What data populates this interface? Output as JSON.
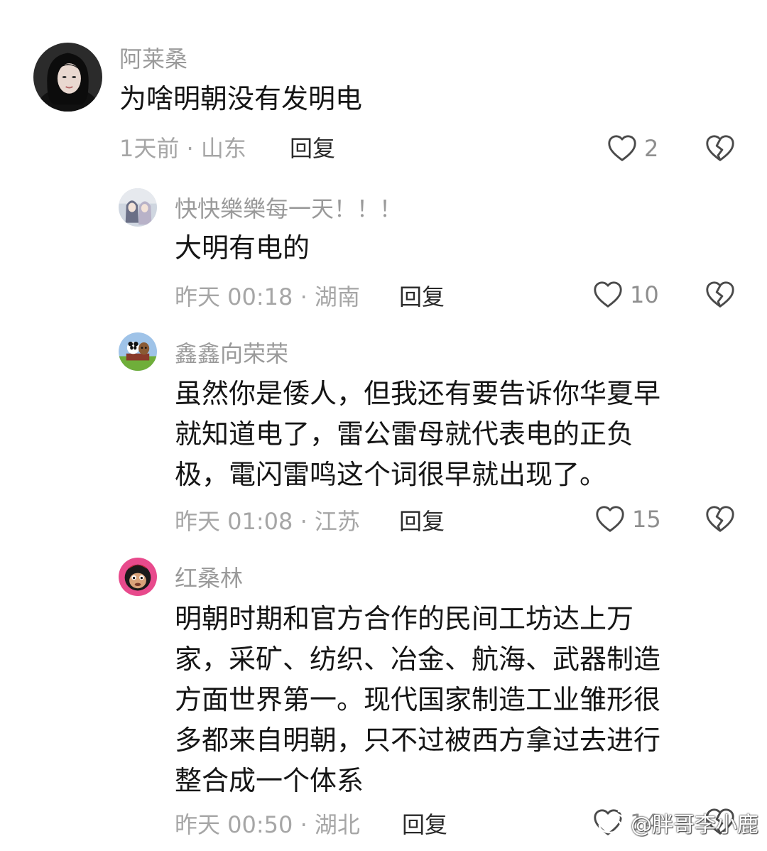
{
  "comments": [
    {
      "username": "阿莱桑",
      "text": "为啥明朝没有发明电",
      "meta": "1天前 · 山东",
      "reply_label": "回复",
      "likes": "2"
    },
    {
      "username": "快快樂樂每一天！！！",
      "text": "大明有电的",
      "meta": "昨天 00:18 · 湖南",
      "reply_label": "回复",
      "likes": "10"
    },
    {
      "username": "鑫鑫向荣荣",
      "text_lines": [
        "虽然你是倭人，但我还有要告诉你华夏早",
        "就知道电了，雷公雷母就代表电的正负",
        "极，電闪雷鸣这个词很早就出现了。"
      ],
      "meta": "昨天 01:08 · 江苏",
      "reply_label": "回复",
      "likes": "15"
    },
    {
      "username": "红桑林",
      "text_lines": [
        "明朝时期和官方合作的民间工坊达上万",
        "家，采矿、纺织、冶金、航海、武器制造",
        "方面世界第一。现代国家制造工业雏形很",
        "多都来自明朝，只不过被西方拿过去进行",
        "整合成一个体系"
      ],
      "meta": "昨天 00:50 · 湖北",
      "reply_label": "回复",
      "likes": "14"
    }
  ],
  "watermark": {
    "text": "@胖哥李小鹿"
  },
  "icons": {
    "like": "heart-outline-icon",
    "dislike": "broken-heart-icon"
  }
}
